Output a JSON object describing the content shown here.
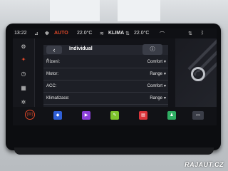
{
  "status": {
    "time": "13:22",
    "auto_label": "AUTO",
    "temp_left": "22.0°C",
    "klima_label": "KLIMA",
    "temp_right": "22.0°C"
  },
  "sidebar": {
    "items": [
      {
        "icon": "car-icon",
        "glyph": "⚙",
        "active": false
      },
      {
        "icon": "steering-icon",
        "glyph": "✦",
        "active": true
      },
      {
        "icon": "clock-icon",
        "glyph": "◷",
        "active": false
      },
      {
        "icon": "seat-icon",
        "glyph": "▦",
        "active": false
      },
      {
        "icon": "settings-icon",
        "glyph": "✲",
        "active": false
      }
    ]
  },
  "panel": {
    "title": "Individual",
    "back_glyph": "‹",
    "info_glyph": "ⓘ",
    "rows": [
      {
        "label": "Řízení:",
        "value": "Comfort"
      },
      {
        "label": "Motor:",
        "value": "Range"
      },
      {
        "label": "ACC:",
        "value": "Comfort"
      },
      {
        "label": "Klimatizace:",
        "value": "Range"
      }
    ]
  },
  "dock": {
    "home_label": "(III)",
    "apps": [
      {
        "name": "nav-app",
        "color": "#2f5fd6",
        "glyph": "◆"
      },
      {
        "name": "media-app",
        "color": "#8b3fd8",
        "glyph": "▶"
      },
      {
        "name": "phone-app",
        "color": "#7ec42d",
        "glyph": "✎"
      },
      {
        "name": "radio-app",
        "color": "#d8343a",
        "glyph": "▤"
      },
      {
        "name": "user-app",
        "color": "#2fae63",
        "glyph": "♟"
      },
      {
        "name": "car-app",
        "color": "#3a3d47",
        "glyph": "▭"
      }
    ]
  },
  "watermark": "RAJAUT.CZ"
}
